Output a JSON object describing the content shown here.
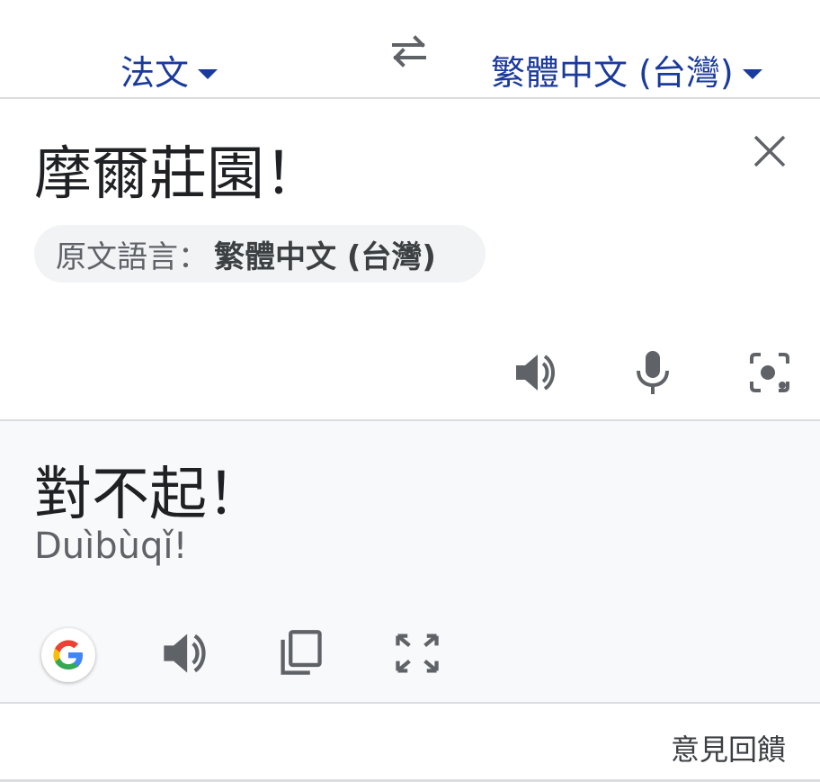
{
  "top_bar": {
    "source_language": "法文",
    "target_language": "繁體中文 (台灣)"
  },
  "source": {
    "text": "摩爾莊園！",
    "detected_label": "原文語言：",
    "detected_language": "繁體中文 (台灣)"
  },
  "result": {
    "text": "對不起！",
    "transliteration": "Duìbùqǐ!"
  },
  "footer": {
    "feedback": "意見回饋"
  },
  "icons": {
    "swap": "swap-icon",
    "clear": "close-icon",
    "listen": "speaker-icon",
    "mic": "microphone-icon",
    "camera": "camera-icon",
    "google": "google-logo-icon",
    "copy": "copy-icon",
    "fullscreen": "fullscreen-icon"
  },
  "colors": {
    "accent": "#1a3a9c",
    "icon": "#5f6368",
    "result_bg": "#f8f9fa"
  }
}
